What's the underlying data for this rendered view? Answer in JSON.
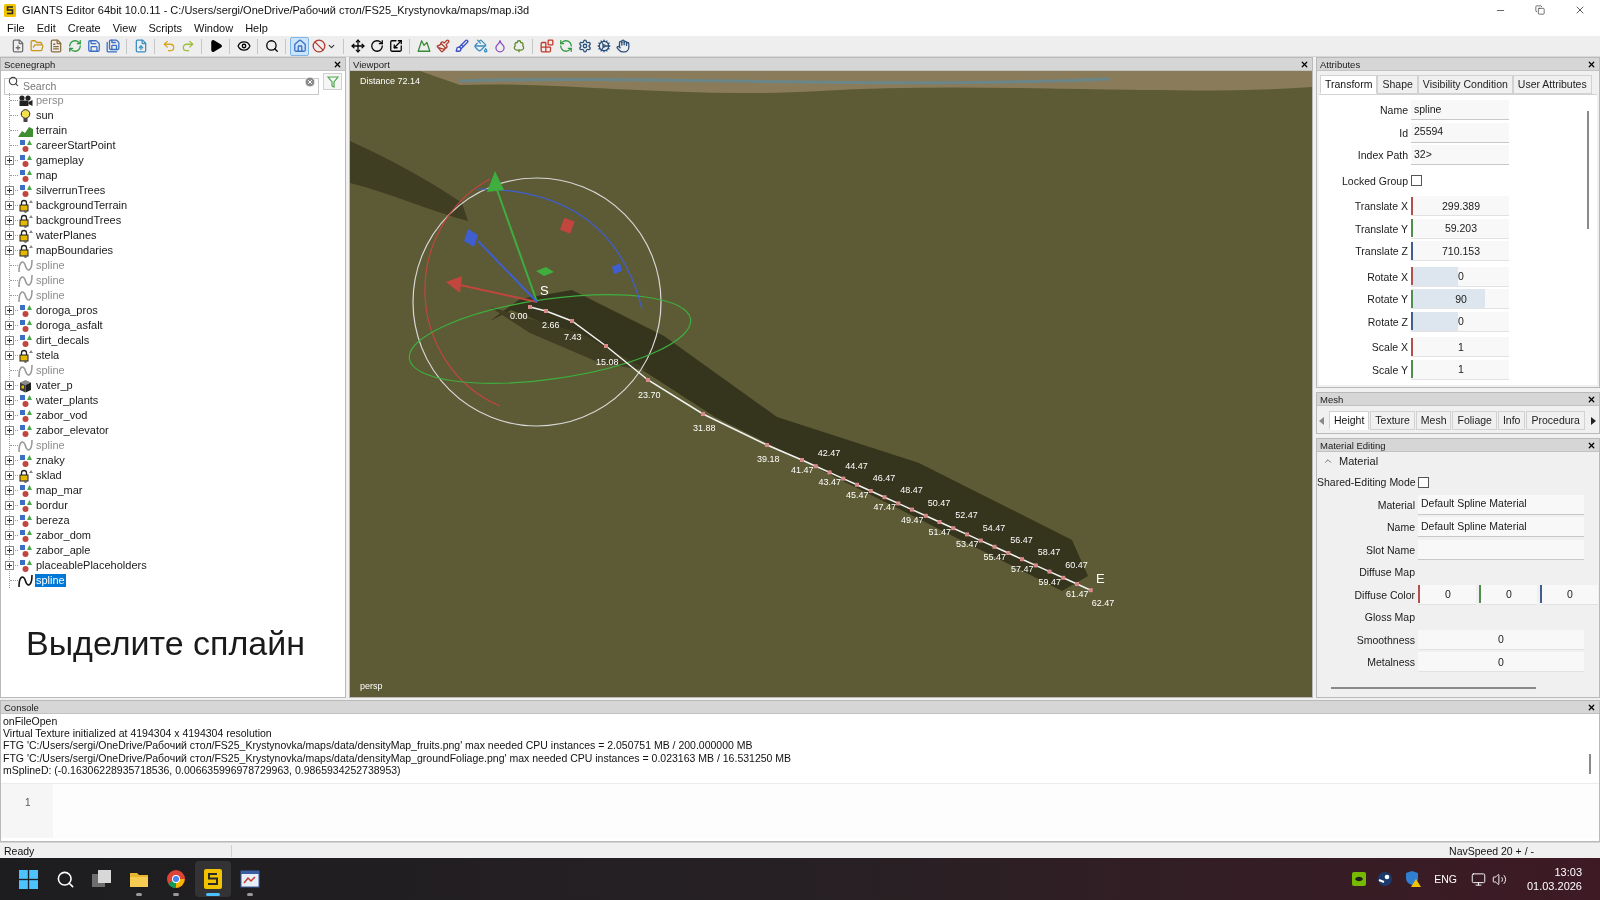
{
  "window": {
    "title": "GIANTS Editor 64bit 10.0.11 - C:/Users/sergi/OneDrive/Рабочий стол/FS25_Krystynovka/maps/map.i3d"
  },
  "menu": [
    "File",
    "Edit",
    "Create",
    "View",
    "Scripts",
    "Window",
    "Help"
  ],
  "toolbar": [
    [
      {
        "on": false
      },
      {
        "on": false
      },
      {
        "on": false
      },
      {
        "on": false
      },
      {
        "on": false
      },
      {
        "on": false
      }
    ],
    [
      {
        "on": false
      }
    ],
    [
      {
        "on": false
      },
      {
        "on": false
      }
    ],
    [
      {
        "on": false
      }
    ],
    [
      {
        "on": false
      }
    ],
    [
      {
        "on": false
      }
    ],
    [
      {
        "on": true
      },
      {
        "on": false
      }
    ],
    [
      {
        "on": false
      },
      {
        "on": false
      },
      {
        "on": false
      }
    ],
    [
      {
        "on": false
      },
      {
        "on": false
      },
      {
        "on": false
      },
      {
        "on": false
      },
      {
        "on": false
      },
      {
        "on": false
      }
    ],
    [
      {
        "on": false
      },
      {
        "on": false
      },
      {
        "on": false
      },
      {
        "on": false
      },
      {
        "on": false
      }
    ]
  ],
  "scenegraph": {
    "title": "Scenegraph",
    "search": {
      "placeholder": "Search"
    },
    "items": [
      {
        "name": "persp",
        "kind": "camera",
        "hidden": true,
        "expandable": false,
        "selected": false
      },
      {
        "name": "sun",
        "kind": "light",
        "hidden": false,
        "expandable": false,
        "selected": false
      },
      {
        "name": "terrain",
        "kind": "terrain",
        "hidden": false,
        "expandable": false,
        "selected": false
      },
      {
        "name": "careerStartPoint",
        "kind": "transform",
        "hidden": false,
        "expandable": false,
        "selected": false
      },
      {
        "name": "gameplay",
        "kind": "transform",
        "hidden": false,
        "expandable": true,
        "selected": false
      },
      {
        "name": "map",
        "kind": "transform",
        "hidden": false,
        "expandable": false,
        "selected": false
      },
      {
        "name": "silverrunTrees",
        "kind": "transform",
        "hidden": false,
        "expandable": true,
        "selected": false
      },
      {
        "name": "backgroundTerrain",
        "kind": "locked",
        "hidden": false,
        "expandable": true,
        "selected": false
      },
      {
        "name": "backgroundTrees",
        "kind": "locked",
        "hidden": false,
        "expandable": true,
        "selected": false
      },
      {
        "name": "waterPlanes",
        "kind": "locked",
        "hidden": false,
        "expandable": true,
        "selected": false
      },
      {
        "name": "mapBoundaries",
        "kind": "locked",
        "hidden": false,
        "expandable": true,
        "selected": false
      },
      {
        "name": "spline",
        "kind": "spline",
        "hidden": true,
        "expandable": false,
        "selected": false
      },
      {
        "name": "spline",
        "kind": "spline",
        "hidden": true,
        "expandable": false,
        "selected": false
      },
      {
        "name": "spline",
        "kind": "spline",
        "hidden": true,
        "expandable": false,
        "selected": false
      },
      {
        "name": "doroga_pros",
        "kind": "transform",
        "hidden": false,
        "expandable": true,
        "selected": false
      },
      {
        "name": "doroga_asfalt",
        "kind": "transform",
        "hidden": false,
        "expandable": true,
        "selected": false
      },
      {
        "name": "dirt_decals",
        "kind": "transform",
        "hidden": false,
        "expandable": true,
        "selected": false
      },
      {
        "name": "stela",
        "kind": "locked",
        "hidden": false,
        "expandable": true,
        "selected": false
      },
      {
        "name": "spline",
        "kind": "spline",
        "hidden": true,
        "expandable": false,
        "selected": false
      },
      {
        "name": "vater_p",
        "kind": "shape",
        "hidden": false,
        "expandable": true,
        "selected": false
      },
      {
        "name": "water_plants",
        "kind": "transform",
        "hidden": false,
        "expandable": true,
        "selected": false
      },
      {
        "name": "zabor_vod",
        "kind": "transform",
        "hidden": false,
        "expandable": true,
        "selected": false
      },
      {
        "name": "zabor_elevator",
        "kind": "transform",
        "hidden": false,
        "expandable": true,
        "selected": false
      },
      {
        "name": "spline",
        "kind": "spline",
        "hidden": true,
        "expandable": false,
        "selected": false
      },
      {
        "name": "znaky",
        "kind": "transform",
        "hidden": false,
        "expandable": true,
        "selected": false
      },
      {
        "name": "sklad",
        "kind": "locked",
        "hidden": false,
        "expandable": true,
        "selected": false
      },
      {
        "name": "map_mar",
        "kind": "transform",
        "hidden": false,
        "expandable": true,
        "selected": false
      },
      {
        "name": "bordur",
        "kind": "transform",
        "hidden": false,
        "expandable": true,
        "selected": false
      },
      {
        "name": "bereza",
        "kind": "transform",
        "hidden": false,
        "expandable": true,
        "selected": false
      },
      {
        "name": "zabor_dom",
        "kind": "transform",
        "hidden": false,
        "expandable": true,
        "selected": false
      },
      {
        "name": "zabor_aple",
        "kind": "transform",
        "hidden": false,
        "expandable": true,
        "selected": false
      },
      {
        "name": "placeablePlaceholders",
        "kind": "transform",
        "hidden": false,
        "expandable": true,
        "selected": false
      },
      {
        "name": "spline",
        "kind": "spline",
        "hidden": false,
        "expandable": false,
        "selected": true
      }
    ],
    "caption": "Выделите сплайн"
  },
  "viewport": {
    "title": "Viewport",
    "distance": "Distance 72.14",
    "camera": "persp",
    "spline": {
      "start": "S",
      "end": "E",
      "labels": [
        "0.00",
        "2.66",
        "7.43",
        "15.08",
        "23.70",
        "31.88",
        "39.18",
        "41.47",
        "42.47",
        "43.47",
        "44.47",
        "45.47",
        "46.47",
        "47.47",
        "48.47",
        "49.47",
        "50.47",
        "51.47",
        "52.47",
        "53.47",
        "54.47",
        "55.47",
        "56.47",
        "57.47",
        "58.47",
        "59.47",
        "60.47",
        "61.47",
        "62.47"
      ]
    }
  },
  "attributes": {
    "title": "Attributes",
    "tabs": [
      {
        "label": "Transform",
        "selected": true
      },
      {
        "label": "Shape",
        "selected": false
      },
      {
        "label": "Visibility Condition",
        "selected": false
      },
      {
        "label": "User Attributes",
        "selected": false
      }
    ],
    "fields": [
      {
        "kind": "text",
        "label": "Name",
        "value": "spline"
      },
      {
        "kind": "text",
        "label": "Id",
        "value": "25594"
      },
      {
        "kind": "text",
        "label": "Index Path",
        "value": "32>"
      },
      {
        "kind": "checkbox",
        "label": "Locked Group",
        "checked": false
      },
      {
        "kind": "number",
        "label": "Translate X",
        "value": "299.389",
        "color": "#b0524b"
      },
      {
        "kind": "number",
        "label": "Translate Y",
        "value": "59.203",
        "color": "#4e8f4e"
      },
      {
        "kind": "number",
        "label": "Translate Z",
        "value": "710.153",
        "color": "#3f5f8f"
      },
      {
        "kind": "slider",
        "label": "Rotate X",
        "value": "0",
        "level": 0.48,
        "color": "#b0524b"
      },
      {
        "kind": "slider",
        "label": "Rotate Y",
        "value": "90",
        "level": 0.75,
        "color": "#4e8f4e"
      },
      {
        "kind": "slider",
        "label": "Rotate Z",
        "value": "0",
        "level": 0.48,
        "color": "#3f5f8f"
      },
      {
        "kind": "number",
        "label": "Scale X",
        "value": "1",
        "color": "#b0524b"
      },
      {
        "kind": "number",
        "label": "Scale Y",
        "value": "1",
        "color": "#4e8f4e"
      }
    ]
  },
  "mesh": {
    "title": "Mesh",
    "tabs": [
      {
        "label": "Height",
        "selected": true
      },
      {
        "label": "Texture",
        "selected": false
      },
      {
        "label": "Mesh",
        "selected": false
      },
      {
        "label": "Foliage",
        "selected": false
      },
      {
        "label": "Info",
        "selected": false
      },
      {
        "label": "Procedura",
        "selected": false
      }
    ]
  },
  "material_editing": {
    "title": "Material Editing",
    "section": {
      "label": "Material",
      "expanded": true
    },
    "fields": [
      {
        "kind": "checkbox",
        "label": "Shared-Editing Mode",
        "checked": false
      },
      {
        "kind": "text",
        "label": "Material",
        "value": "Default Spline Material"
      },
      {
        "kind": "text",
        "label": "Name",
        "value": "Default Spline Material"
      },
      {
        "kind": "text",
        "label": "Slot Name"
      },
      {
        "kind": "label",
        "label": "Diffuse Map"
      },
      {
        "kind": "color",
        "label": "Diffuse Color",
        "channels": [
          {
            "value": "0",
            "color": "#b0524b"
          },
          {
            "value": "0",
            "color": "#4e8f4e"
          },
          {
            "value": "0",
            "color": "#3f5f8f"
          }
        ]
      },
      {
        "kind": "label",
        "label": "Gloss Map"
      },
      {
        "kind": "number",
        "label": "Smoothness",
        "value": "0"
      },
      {
        "kind": "number",
        "label": "Metalness",
        "value": "0"
      }
    ]
  },
  "console": {
    "title": "Console",
    "lines": [
      "onFileOpen",
      "Virtual Texture initialized at 4194304 x 4194304 resolution",
      "FTG 'C:/Users/sergi/OneDrive/Рабочий стол/FS25_Krystynovka/maps/data/densityMap_fruits.png' max needed CPU instances = 2.050751 MB / 200.000000 MB",
      "FTG 'C:/Users/sergi/OneDrive/Рабочий стол/FS25_Krystynovka/maps/data/densityMap_groundFoliage.png' max needed CPU instances = 0.023163 MB / 16.531250 MB",
      "mSplineD: (-0.16306228935718536, 0.006635996978729963, 0.9865934252738953)"
    ],
    "input": {
      "line_number": "1"
    }
  },
  "status_bar": {
    "left": "Ready",
    "right": "NavSpeed 20 + / -"
  },
  "taskbar": {
    "apps": [
      {
        "selected": false,
        "running": true
      },
      {
        "selected": false,
        "running": true
      },
      {
        "selected": true,
        "running": true
      },
      {
        "selected": false,
        "running": true
      }
    ],
    "language": "ENG",
    "time": "13:03",
    "date": "01.03.2026"
  }
}
